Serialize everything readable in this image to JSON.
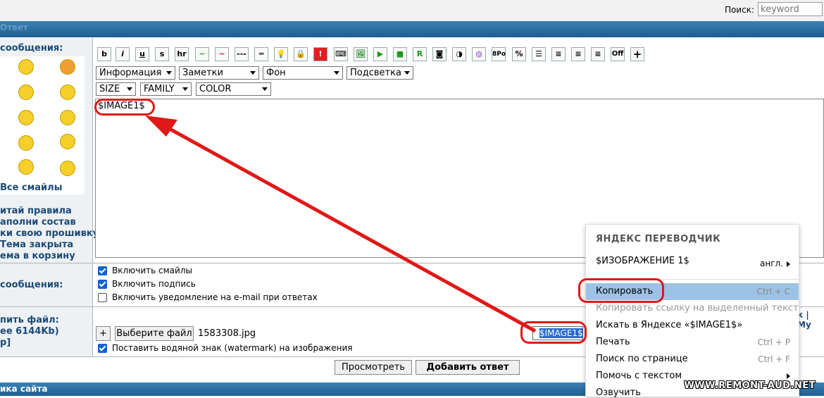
{
  "header": {
    "search_label": "Поиск:",
    "search_placeholder": "keyword",
    "top_bar_text": "Ответ"
  },
  "left": {
    "message_section": "сообщения:",
    "all_smiles": "Все смайлы",
    "links": [
      "итай правила",
      "аполни состав",
      "ки свою прошивку",
      "Тема закрыта",
      "ема в корзину"
    ],
    "options_section": "сообщения:",
    "upload": [
      "пить файл:",
      "ее 6144Kb)",
      "p]"
    ]
  },
  "toolbar": {
    "buttons": [
      "b",
      "i",
      "u",
      "s",
      "hr",
      "~",
      "~",
      "---",
      "═",
      "💡",
      "🔒",
      "!",
      "⌨",
      "🖼",
      "▶",
      "■",
      "R",
      "◙",
      "◑",
      "◍",
      "8Po",
      "%",
      "☰",
      "≡",
      "≡",
      "≡",
      "Off",
      "+"
    ],
    "selects_row1": [
      "Информация",
      "Заметки",
      "Фон",
      "Подсветка"
    ],
    "selects_row2": [
      "SIZE",
      "FAMILY",
      "COLOR"
    ]
  },
  "editor": {
    "content": "$IMAGE1$"
  },
  "options": {
    "enable_smiles": "Включить смайлы",
    "enable_signature": "Включить подпись",
    "email_notify": "Включить уведомление на e-mail при ответах"
  },
  "upload": {
    "plus": "+",
    "choose_file": "Выберите файл",
    "file_name": "1583308.jpg",
    "tag": "$IMAGE1$",
    "watermark": "Поставить водяной знак (watermark) на изображения",
    "right_links": "к | Му"
  },
  "actions": {
    "preview": "Просмотреть",
    "submit": "Добавить ответ"
  },
  "context_menu": {
    "title": "ЯНДЕКС ПЕРЕВОДЧИК",
    "translation": "$ИЗОБРАЖЕНИЕ 1$",
    "lang": "англ.",
    "items": [
      {
        "label": "Копировать",
        "shortcut": "Ctrl + C"
      },
      {
        "label": "Копировать ссылку на выделенный текст",
        "shortcut": ""
      },
      {
        "label": "Искать в Яндексе «$IMAGE1$»",
        "shortcut": ""
      },
      {
        "label": "Печать",
        "shortcut": "Ctrl + P"
      },
      {
        "label": "Поиск по странице",
        "shortcut": "Ctrl + F"
      },
      {
        "label": "Помочь с текстом",
        "shortcut": ""
      },
      {
        "label": "Озвучить",
        "shortcut": ""
      }
    ]
  },
  "footer": {
    "left_text": "ика сайта",
    "watermark": "WWW.REMONT-AUD.NET"
  },
  "colors": {
    "accent": "#1e5f93",
    "annotation": "#e01818",
    "selection": "#9cc3e6"
  }
}
